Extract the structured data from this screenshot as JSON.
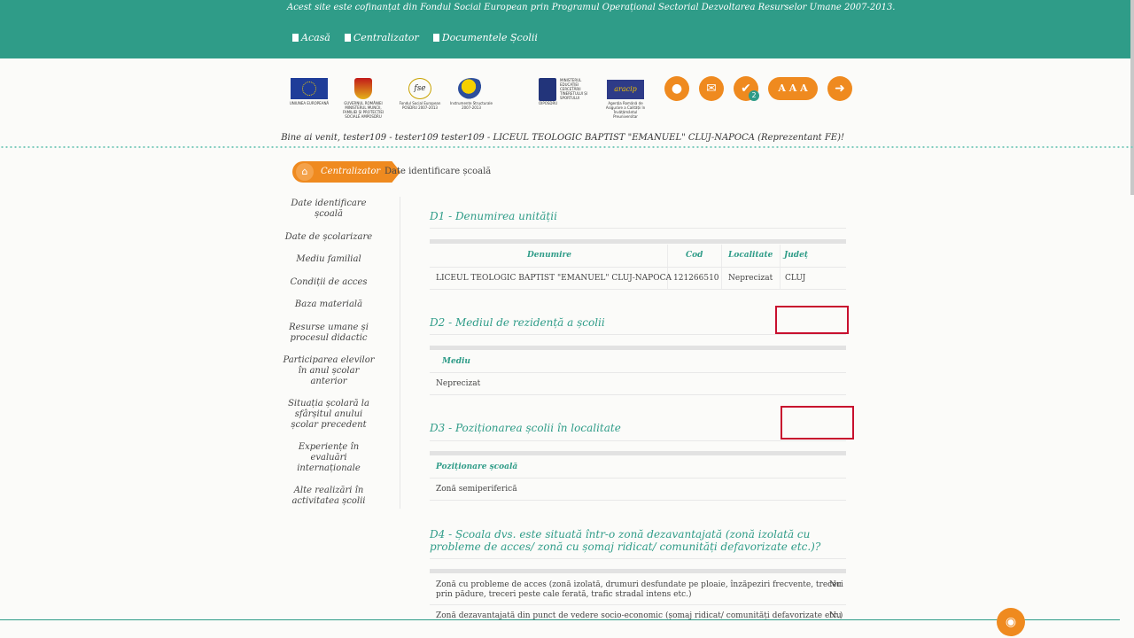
{
  "header": {
    "cofinantare": "Acest site este cofinanțat din Fondul Social European prin Programul Operațional Sectorial Dezvoltarea Resurselor Umane 2007-2013.",
    "nav": [
      "Acasă",
      "Centralizator",
      "Documentele Școlii"
    ]
  },
  "logos": {
    "eu": "UNIUNEA EUROPEANĂ",
    "gov": "GUVERNUL ROMÂNIEI MINISTERUL MUNCII, FAMILIEI ȘI PROTECȚIEI SOCIALE AMPOSDRU",
    "fse_text": "fse",
    "fse": "Fondul Social European POSDRU 2007-2013",
    "is": "Instrumente Structurale 2007-2013",
    "min": "MINISTERUL EDUCAȚIEI CERCETĂRII TINERETULUI ȘI SPORTULUI",
    "min_sub": "OIPOSDRU",
    "aracip_text": "aracip",
    "aracip": "Agenția Română de Asigurare a Calității în Învățământul Preuniversitar"
  },
  "tools": {
    "notif_count": "2",
    "font_label": "A A A"
  },
  "welcome": "Bine ai venit, tester109 - tester109 tester109 - LICEUL TEOLOGIC BAPTIST \"EMANUEL\" CLUJ-NAPOCA (Reprezentant FE)!",
  "breadcrumb": {
    "parent": "Centralizator",
    "current": "Date identificare școală"
  },
  "sidebar": [
    [
      "Date identificare",
      "școală"
    ],
    [
      "Date de școlarizare"
    ],
    [
      "Mediu familial"
    ],
    [
      "Condiții de acces"
    ],
    [
      "Baza materială"
    ],
    [
      "Resurse umane și",
      "procesul didactic"
    ],
    [
      "Participarea elevilor",
      "în anul școlar",
      "anterior"
    ],
    [
      "Situația școlară la",
      "sfârșitul anului",
      "școlar precedent"
    ],
    [
      "Experiențe în",
      "evaluări",
      "internaționale"
    ],
    [
      "Alte realizări în",
      "activitatea școlii"
    ]
  ],
  "d1": {
    "title": "D1 - Denumirea unității",
    "headers": [
      "Denumire",
      "Cod",
      "Localitate",
      "Județ"
    ],
    "row": [
      "LICEUL TEOLOGIC BAPTIST \"EMANUEL\" CLUJ-NAPOCA",
      "121266510",
      "Neprecizat",
      "CLUJ"
    ]
  },
  "d2": {
    "title": "D2 - Mediul de rezidență a școlii",
    "header": "Mediu",
    "value": "Neprecizat"
  },
  "d3": {
    "title": "D3 - Poziționarea școlii în localitate",
    "header": "Poziționare școală",
    "value": "Zonă semiperiferică"
  },
  "d4": {
    "title": "D4 - Școala dvs. este situată într-o zonă dezavantajată (zonă izolată cu probleme de acces/ zonă cu șomaj ridicat/ comunități defavorizate etc.)?",
    "rows": [
      {
        "q": [
          "Zonă cu probleme de acces (zonă izolată, drumuri desfundate pe ploaie, înzăpeziri frecvente, treceri",
          "prin pădure, treceri peste cale ferată, trafic stradal intens etc.)"
        ],
        "a": "Nu"
      },
      {
        "q": [
          "Zonă dezavantajată din punct de vedere socio-economic (șomaj ridicat/ comunități defavorizate etc.)"
        ],
        "a": "Nu"
      }
    ]
  },
  "colors": {
    "teal": "#2f9c88",
    "orange": "#ef8a1f",
    "highlight": "#c8102e"
  }
}
